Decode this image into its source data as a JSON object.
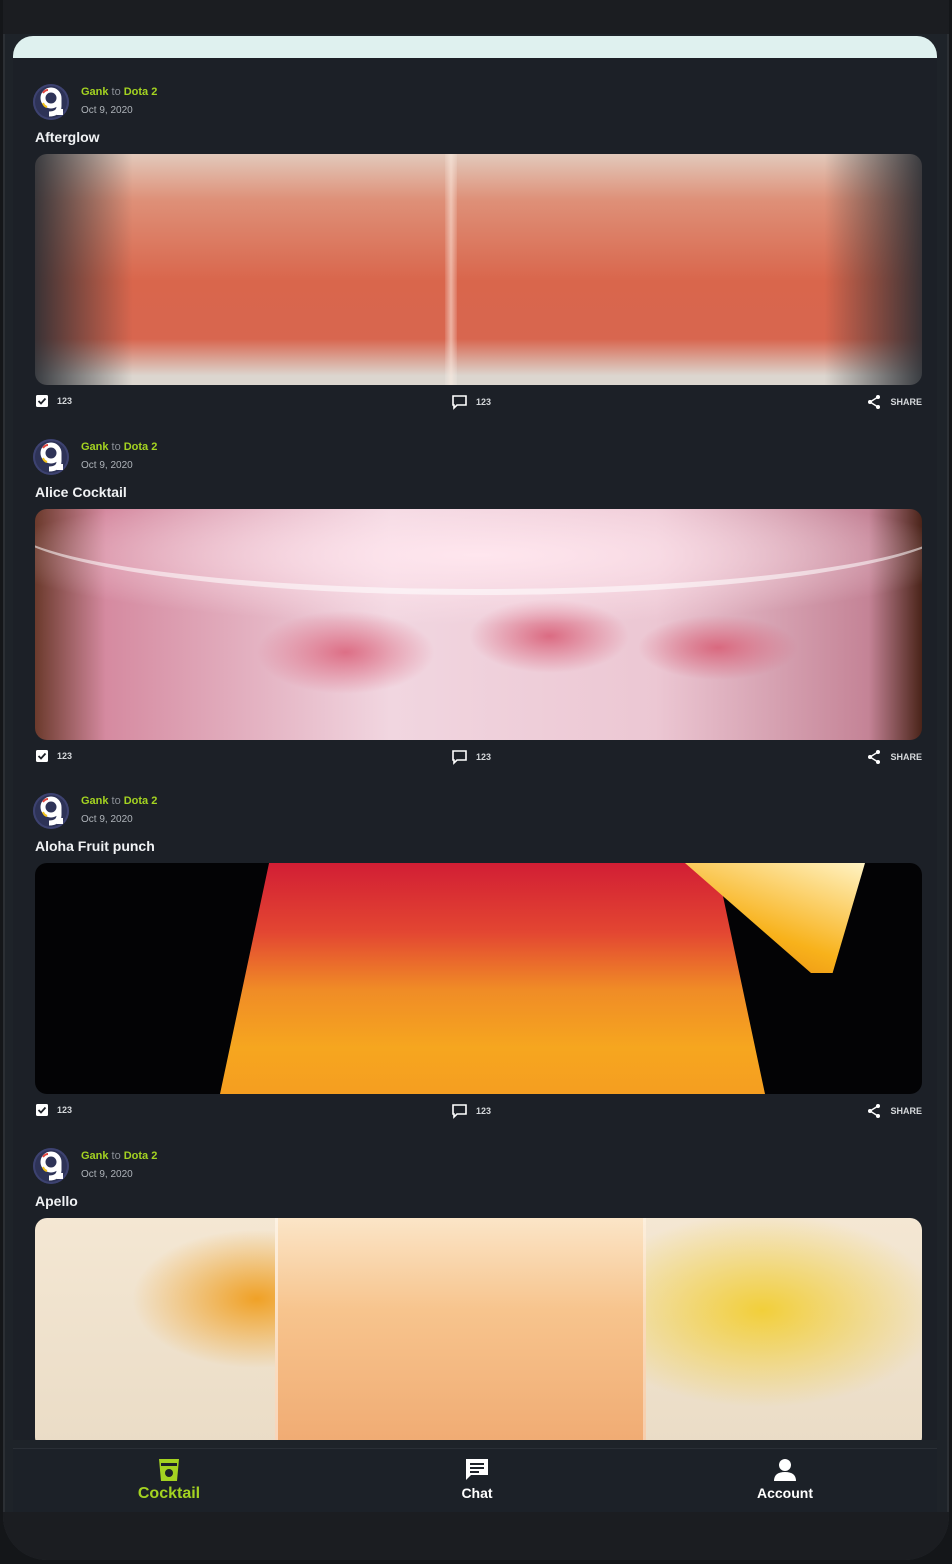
{
  "posts": [
    {
      "author": "Gank",
      "connector": "to",
      "community": "Dota 2",
      "date": "Oct 9, 2020",
      "title": "Afterglow",
      "likes": "123",
      "comments": "123",
      "share": "SHARE"
    },
    {
      "author": "Gank",
      "connector": "to",
      "community": "Dota 2",
      "date": "Oct 9, 2020",
      "title": "Alice Cocktail",
      "likes": "123",
      "comments": "123",
      "share": "SHARE"
    },
    {
      "author": "Gank",
      "connector": "to",
      "community": "Dota 2",
      "date": "Oct 9, 2020",
      "title": "Aloha Fruit punch",
      "likes": "123",
      "comments": "123",
      "share": "SHARE"
    },
    {
      "author": "Gank",
      "connector": "to",
      "community": "Dota 2",
      "date": "Oct 9, 2020",
      "title": "Apello"
    }
  ],
  "nav": {
    "items": [
      {
        "label": "Cocktail",
        "icon": "cocktail-glass-icon",
        "active": true
      },
      {
        "label": "Chat",
        "icon": "chat-bubble-icon",
        "active": false
      },
      {
        "label": "Account",
        "icon": "person-icon",
        "active": false
      }
    ]
  },
  "colors": {
    "accent": "#a4d321",
    "background": "#1c2027",
    "text": "#f0f2f4",
    "banner": "#dff1ef"
  }
}
